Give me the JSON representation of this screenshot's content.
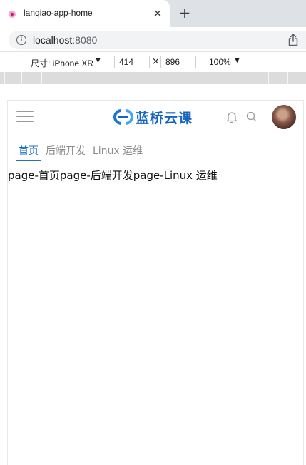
{
  "browser": {
    "tab_title": "lanqiao-app-home",
    "close_glyph": "✕",
    "new_tab_glyph": "+",
    "url_host": "localhost",
    "url_port": ":8080"
  },
  "devtools": {
    "device_label": "尺寸: iPhone XR",
    "caret": "▼",
    "width": "414",
    "height": "896",
    "times": "×",
    "zoom": "100%"
  },
  "app": {
    "brand": "蓝桥云课",
    "brand_color": "#1565c0",
    "accent_color": "#1e73c9",
    "icons": [
      "menu-icon",
      "logo-icon",
      "bell-icon",
      "search-icon"
    ],
    "tabs": [
      {
        "label": "首页",
        "active": true
      },
      {
        "label": "后端开发",
        "active": false
      },
      {
        "label": "Linux 运维",
        "active": false
      }
    ],
    "content_text": "page-首页page-后端开发page-Linux 运维"
  }
}
